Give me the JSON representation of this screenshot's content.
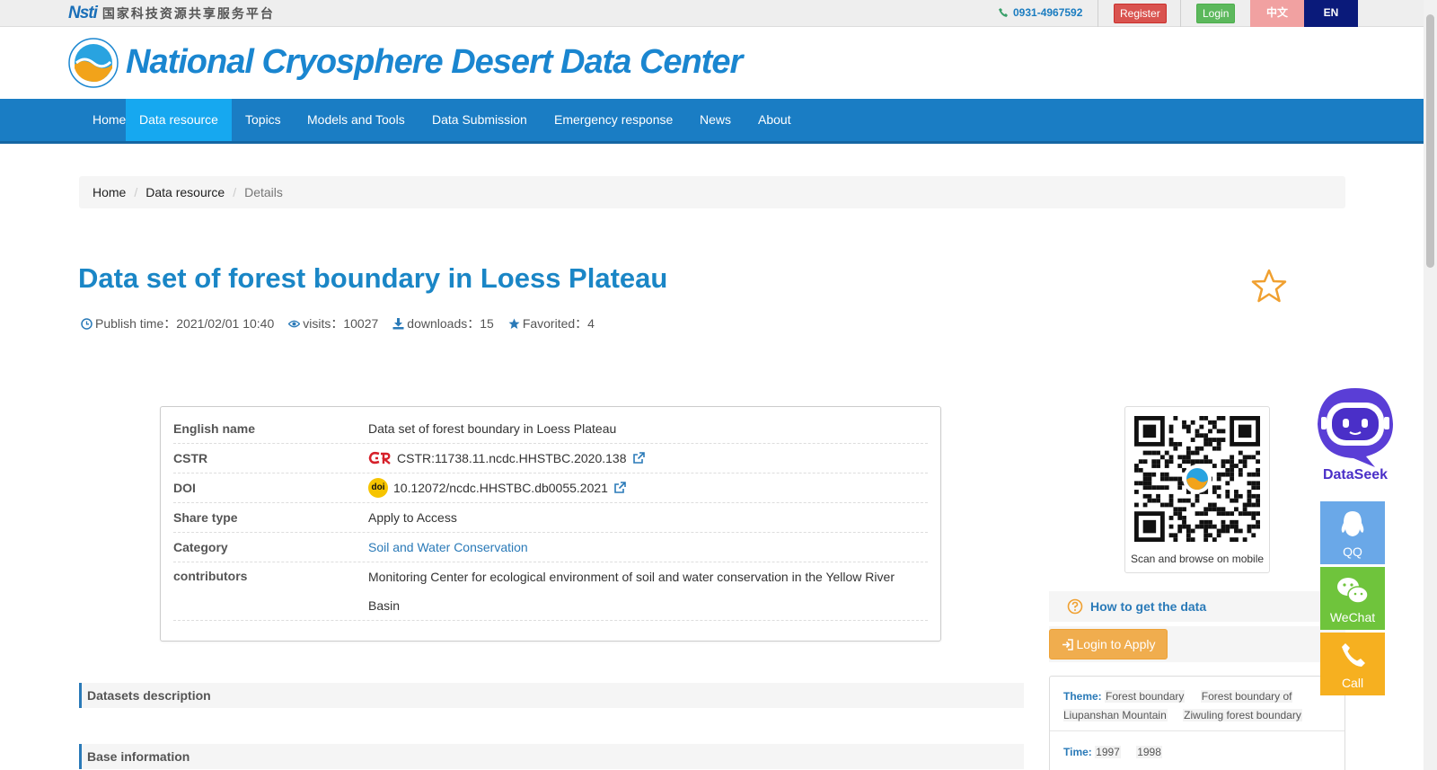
{
  "topbar": {
    "platform_text": "国家科技资源共享服务平台",
    "platform_logo_text": "Nsti",
    "phone": "0931-4967592",
    "register_label": "Register",
    "login_label": "Login",
    "lang_cn_label": "中文",
    "lang_en_label": "EN"
  },
  "header": {
    "site_title": "National Cryosphere Desert Data Center"
  },
  "nav": {
    "items": [
      {
        "label": "Home"
      },
      {
        "label": "Data resource"
      },
      {
        "label": "Topics"
      },
      {
        "label": "Models and Tools"
      },
      {
        "label": "Data Submission"
      },
      {
        "label": "Emergency response"
      },
      {
        "label": "News"
      },
      {
        "label": "About"
      }
    ],
    "active": "Data resource"
  },
  "breadcrumb": {
    "items": [
      "Home",
      "Data resource"
    ],
    "current": "Details"
  },
  "dataset": {
    "title": "Data set of forest boundary in Loess Plateau",
    "publish_time": "Publish time：2021/02/01 10:40",
    "visits": "visits：10027",
    "downloads": "downloads：15",
    "favorited": "Favorited：4"
  },
  "details": {
    "english_name_label": "English name",
    "english_name": "Data set of forest boundary in Loess Plateau",
    "cstr_label": "CSTR",
    "cstr": "CSTR:11738.11.ncdc.HHSTBC.2020.138",
    "doi_label": "DOI",
    "doi_badge": "doi",
    "doi": "10.12072/ncdc.HHSTBC.db0055.2021",
    "share_type_label": "Share type",
    "share_type": "Apply to Access",
    "category_label": "Category",
    "category": "Soil and Water Conservation",
    "contributors_label": "contributors",
    "contributors": "Monitoring Center for ecological environment of soil and water conservation in the Yellow River Basin"
  },
  "sections": {
    "description": "Datasets description",
    "base_info": "Base information"
  },
  "sidebar": {
    "qr_caption": "Scan and browse on mobile",
    "howto_label": "How to get the data",
    "apply_label": "Login to Apply",
    "theme_label": "Theme:",
    "theme_tags": [
      "Forest boundary",
      "Forest boundary of Liupanshan Mountain",
      "Ziwuling forest boundary"
    ],
    "time_label": "Time:",
    "time_tags": [
      "1997",
      "1998"
    ]
  },
  "floating": {
    "robot_label": "DataSeek",
    "qq_label": "QQ",
    "wechat_label": "WeChat",
    "call_label": "Call"
  },
  "colors": {
    "brand_blue": "#1a7dc4",
    "title_blue": "#1a86c6",
    "nav_active": "#16a8f0",
    "register": "#d9534f",
    "login": "#5cb85c",
    "apply": "#f0ad4e"
  }
}
